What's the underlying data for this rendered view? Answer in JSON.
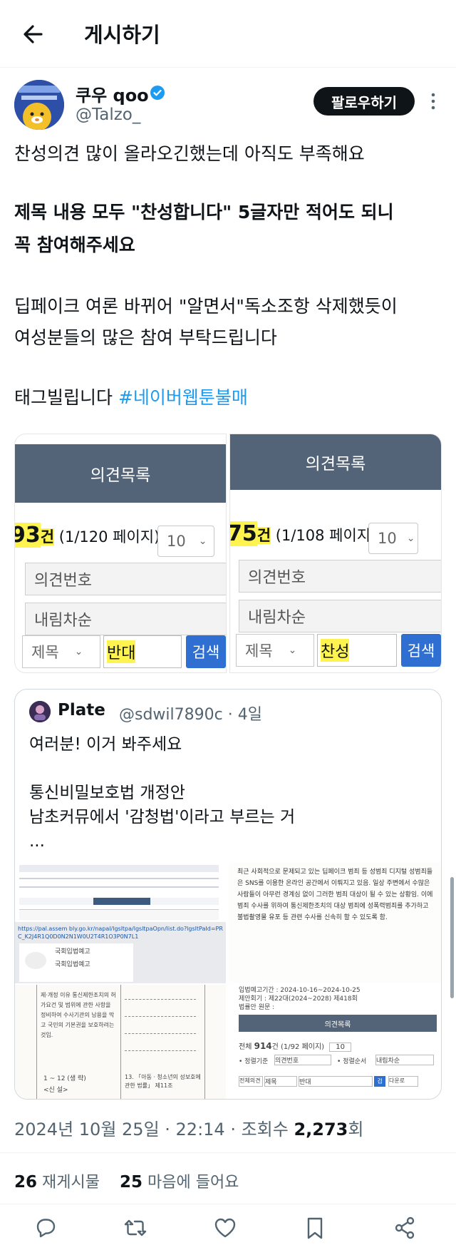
{
  "header": {
    "title": "게시하기"
  },
  "author": {
    "name": "쿠우 qoo",
    "handle": "@Talzo_",
    "follow_label": "팔로우하기"
  },
  "post": {
    "line1": "찬성의견 많이 올라오긴했는데 아직도 부족해요",
    "bold1": "제목 내용 모두 \"찬성합니다\" 5글자만 적어도 되니",
    "bold2": "꼭 참여해주세요",
    "line3a": "딥페이크 여론 바뀌어 \"알면서\"독소조항 삭제했듯이",
    "line3b": "여성분들의 많은 참여 부탁드립니다",
    "tag_text": "태그빌립니다",
    "hashtag": "#네이버웹툰불매"
  },
  "panels": [
    {
      "header": "의견목록",
      "count_num": "93",
      "count_unit": "건",
      "page_info": "(1/120 페이지)",
      "per_page": "10",
      "sort1": "의견번호",
      "sort2": "내림차순",
      "field": "제목",
      "query": "반대",
      "search_label": "검색"
    },
    {
      "header": "의견목록",
      "count_num": "75",
      "count_unit": "건",
      "page_info": "(1/108 페이지)",
      "per_page": "10",
      "sort1": "의견번호",
      "sort2": "내림차순",
      "field": "제목",
      "query": "찬성",
      "search_label": "검색"
    }
  ],
  "quote": {
    "name": "Plate",
    "handle": "@sdwil7890c · 4일",
    "line1": "여러분! 이거 봐주세요",
    "line2": "통신비밀보호법 개정안",
    "line3": "남초커뮤에서 '감청법'이라고 부르는 거",
    "ellipsis": "...",
    "thumb1": {
      "url": "https://pal.assem bly.go.kr/napal/lgsltpa/lgsltpaOpn/list.do?lgsltPaId=PRC_K2J4R1Q0D0N2N1W0U2T4R1O3P0N7L1",
      "tag1": "국회입법예고",
      "tag2": "국회입법예고"
    },
    "thumb2": {
      "text": "최근 사회적으로 문제되고 있는 딥페이크 범죄 등 성범죄 디지털 성범죄들은 SNS를 이용한 온라인 공간에서 이뤄지고 있음. 일상 주변에서 수많은 사람들이 아무런 경계심 없이 그러한 범죄 대상이 될 수 있는 상황임. 이에 범죄 수사를 위하여 통신제한조치의 대상 범죄에 성폭력범죄를 추가하고 불법촬영물 유포 등 관련 수사를 신속히 할 수 있도록 함."
    },
    "thumb3": {
      "text": "제·개정 이유 통신제한조치의 허가요건 및 범위에 관한 사항을 정비하여 수사기관의 남용을 막고 국민의 기본권을 보호하려는 것임.",
      "item": "1 ~ 12 (생 략)",
      "item2": "<신 설>",
      "item3": "13. 「아동ㆍ청소년의 성보호에 관한 법률」 제11조"
    },
    "thumb4": {
      "period": "입법예고기간 : 2024-10-16~2024-10-25",
      "proposer": "제안회기 : 제22대(2024~2028) 제418회",
      "original": "법률안 원문 :",
      "header": "의견목록",
      "count_prefix": "전체",
      "count": "914",
      "count_suffix": "건 (1/92 페이지)",
      "per_page": "10",
      "sort_label": "• 정렬기준",
      "sort_value": "의견번호",
      "order_label": "• 정렬순서",
      "order_value": "내림차순",
      "all_label": "전체의견",
      "field": "제목",
      "query": "반대",
      "search": "검",
      "next": "다운로"
    }
  },
  "meta": {
    "date": "2024년 10월 25일 · 22:14 · 조회수 ",
    "views": "2,273",
    "views_suffix": "회"
  },
  "counts": {
    "reposts": "26",
    "reposts_label": "재게시물",
    "likes": "25",
    "likes_label": "마음에 들어요"
  }
}
